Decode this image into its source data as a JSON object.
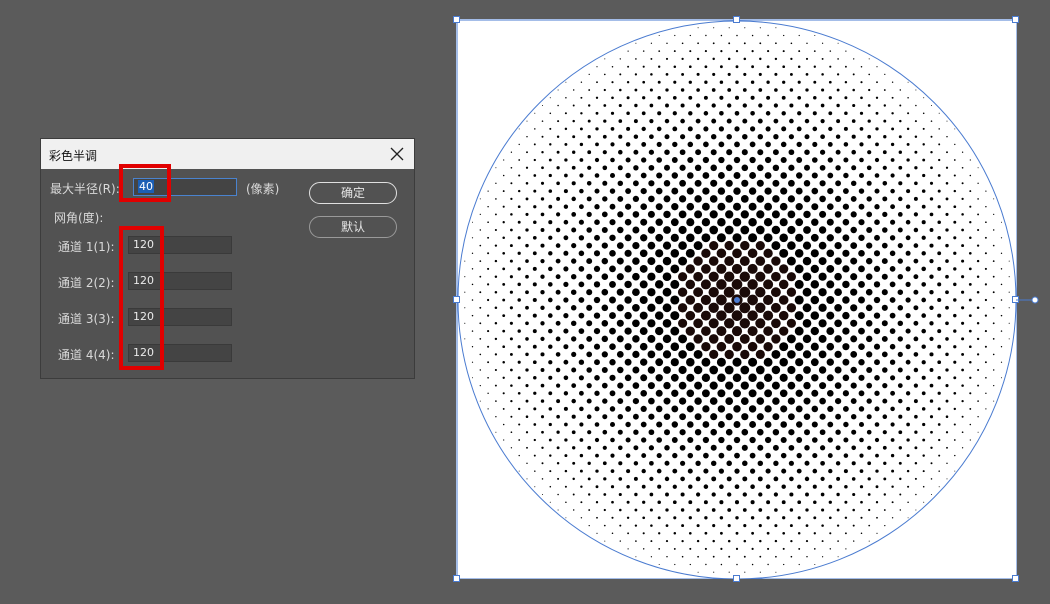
{
  "dialog": {
    "title": "彩色半调",
    "max_radius_label": "最大半径(R):",
    "max_radius_value": "40",
    "unit_label": "(像素)",
    "screen_angle_label": "网角(度):",
    "channels": [
      {
        "label": "通道 1(1):",
        "value": "120"
      },
      {
        "label": "通道 2(2):",
        "value": "120"
      },
      {
        "label": "通道 3(3):",
        "value": "120"
      },
      {
        "label": "通道 4(4):",
        "value": "120"
      }
    ],
    "ok_button": "确定",
    "default_button": "默认"
  },
  "colors": {
    "app_background": "#5b5b5b",
    "dialog_background": "#525252",
    "highlight": "#e10000",
    "selection_outline": "#4a7bd0"
  },
  "icons": {
    "close": "close-icon"
  }
}
